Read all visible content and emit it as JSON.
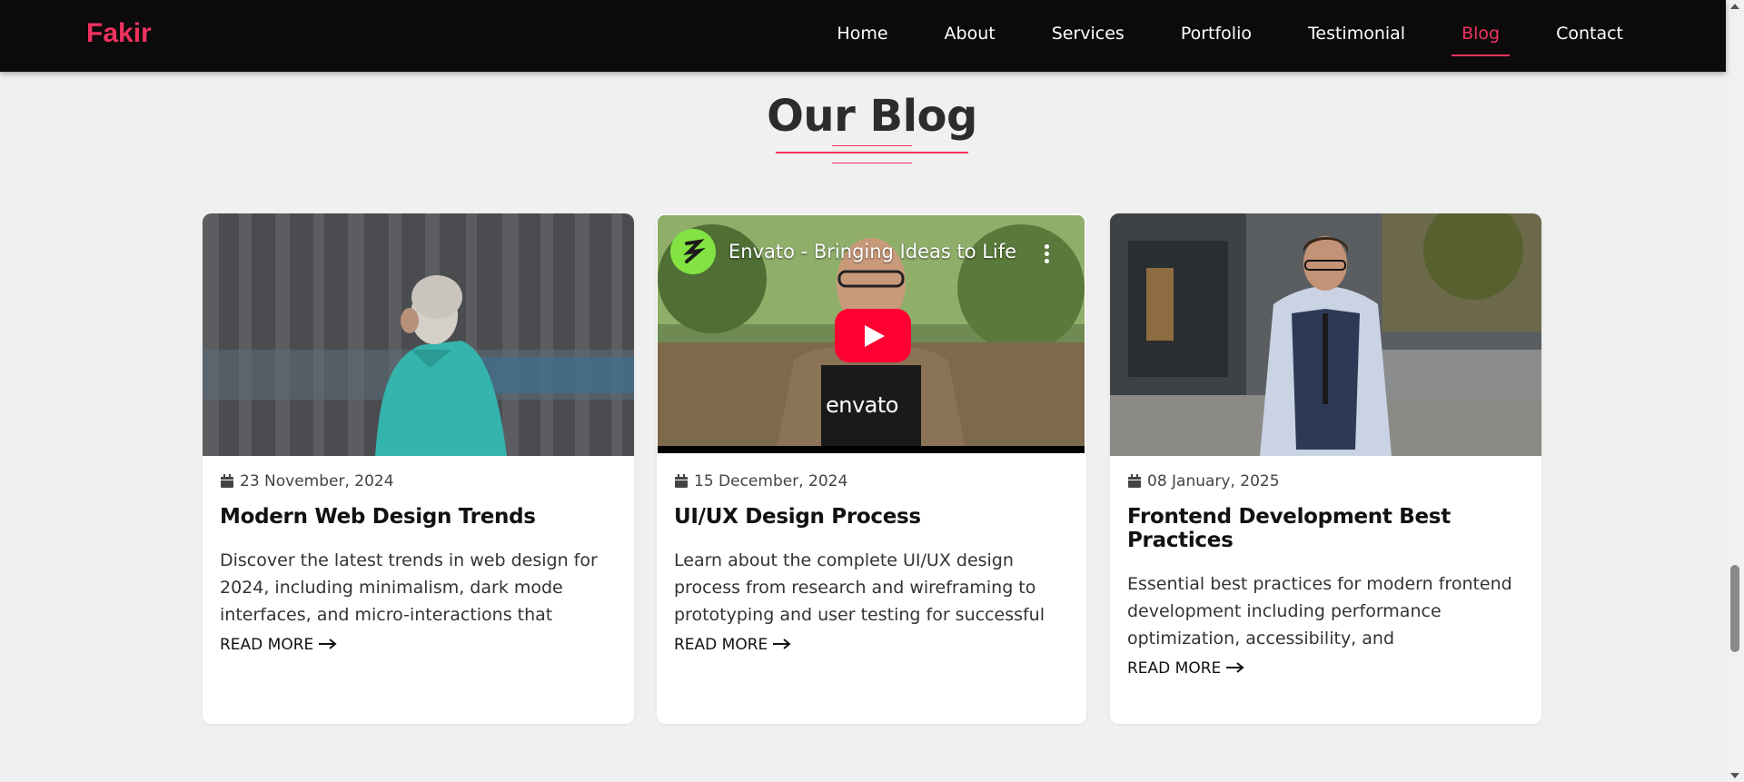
{
  "brand": "Fakir",
  "nav": [
    "Home",
    "About",
    "Services",
    "Portfolio",
    "Testimonial",
    "Blog",
    "Contact"
  ],
  "active_nav": "Blog",
  "colors": {
    "accent": "#f0325f",
    "navbar_bg": "#0b0b0b",
    "page_bg": "#f0f0f0"
  },
  "section_title": "Our Blog",
  "posts": [
    {
      "date": "23 November, 2024",
      "title": "Modern Web Design Trends",
      "excerpt": "Discover the latest trends in web design for 2024, including minimalism, dark mode interfaces, and micro-interactions that enhance user experience.",
      "read_more": "READ MORE"
    },
    {
      "date": "15 December, 2024",
      "title": "UI/UX Design Process",
      "excerpt": "Learn about the complete UI/UX design process from research and wireframing to prototyping and user testing for successful digital products.",
      "read_more": "READ MORE",
      "video": {
        "title": "Envato - Bringing Ideas to Life",
        "brand_text": "envato"
      }
    },
    {
      "date": "08 January, 2025",
      "title": "Frontend Development Best Practices",
      "excerpt": "Essential best practices for modern frontend development including performance optimization, accessibility, and maintainable…",
      "read_more": "READ MORE"
    }
  ],
  "icons": {
    "date": "calendar-icon",
    "read_more": "arrow-right-icon",
    "video_play": "play-icon",
    "video_menu": "more-vertical-icon"
  }
}
